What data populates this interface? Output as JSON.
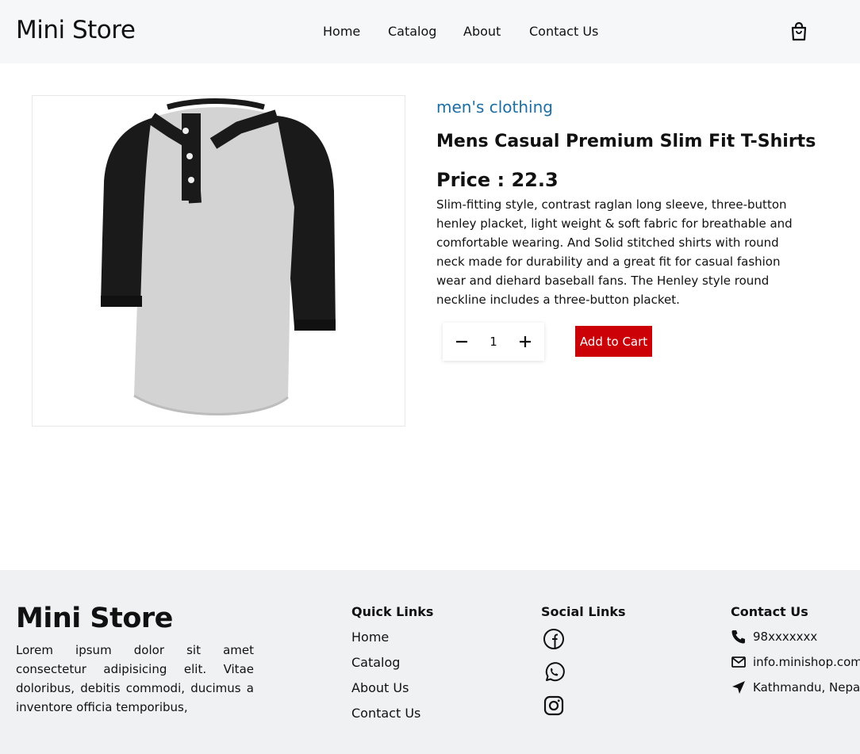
{
  "header": {
    "brand": "Mini Store",
    "nav": [
      "Home",
      "Catalog",
      "About",
      "Contact Us"
    ],
    "cart_icon": "shopping-bag-icon"
  },
  "product": {
    "category": "men's clothing",
    "title": "Mens Casual Premium Slim Fit T-Shirts",
    "price": "Price : 22.3",
    "description": "Slim-fitting style, contrast raglan long sleeve, three-button henley placket, light weight & soft fabric for breathable and comfortable wearing. And Solid stitched shirts with round neck made for durability and a great fit for casual fashion wear and diehard baseball fans. The Henley style round neckline includes a three-button placket.",
    "quantity": "1",
    "add_to_cart": "Add to Cart",
    "accent_color": "#cc0007",
    "category_color": "#1d6fa3"
  },
  "footer": {
    "brand": "Mini Store",
    "about": "Lorem ipsum dolor sit amet consectetur adipisicing elit. Vitae doloribus, debitis commodi, ducimus a inventore officia temporibus,",
    "quick_links_title": "Quick Links",
    "quick_links": [
      "Home",
      "Catalog",
      "About Us",
      "Contact Us"
    ],
    "social_title": "Social Links",
    "social_icons": [
      "facebook-icon",
      "whatsapp-icon",
      "instagram-icon"
    ],
    "contact_title": "Contact Us",
    "contact": {
      "phone": "98xxxxxxx",
      "email": "info.minishop.com",
      "location": "Kathmandu, Nepal"
    }
  }
}
